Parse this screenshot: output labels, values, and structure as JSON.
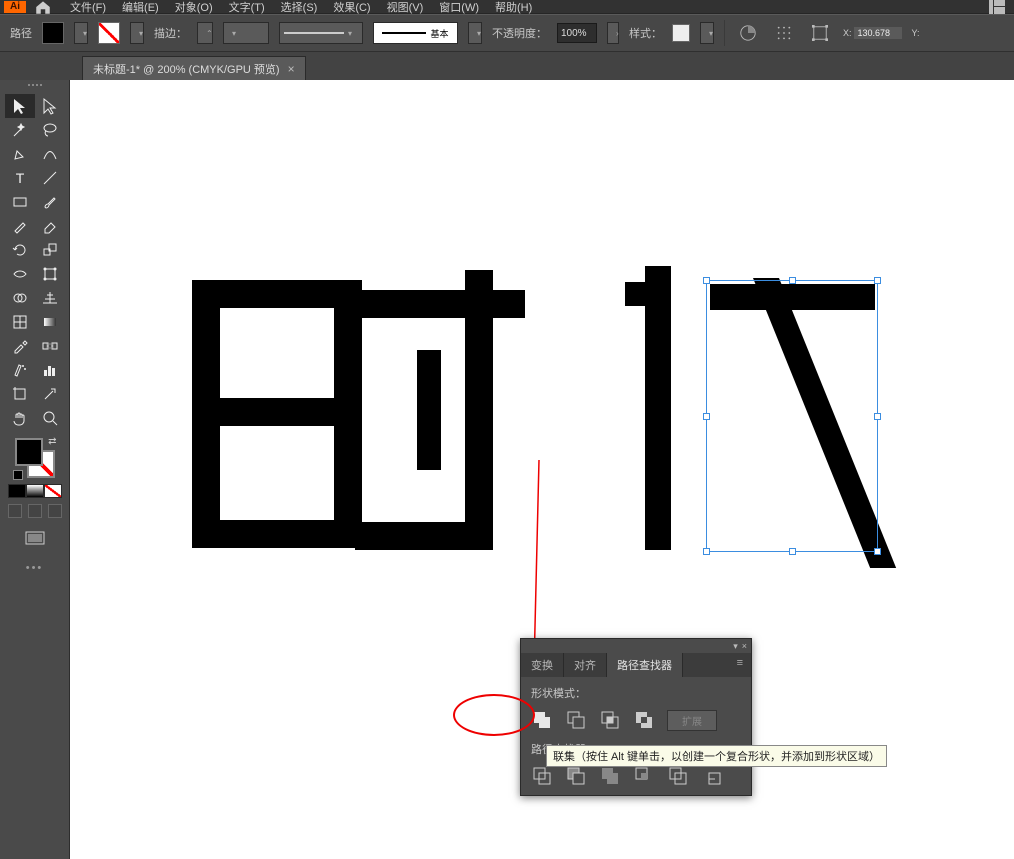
{
  "app": {
    "logo": "Ai"
  },
  "menu": {
    "items": [
      "文件(F)",
      "编辑(E)",
      "对象(O)",
      "文字(T)",
      "选择(S)",
      "效果(C)",
      "视图(V)",
      "窗口(W)",
      "帮助(H)"
    ]
  },
  "control": {
    "mode": "路径",
    "stroke_label": "描边：",
    "stroke_style": "基本",
    "opacity_label": "不透明度：",
    "opacity_value": "100%",
    "style_label": "样式：",
    "x_label": "X:",
    "x_value": "130.678",
    "y_label": "Y:"
  },
  "tab": {
    "title": "未标题-1* @ 200% (CMYK/GPU 预览)",
    "close": "×"
  },
  "panel": {
    "tabs": [
      "变换",
      "对齐",
      "路径查找器"
    ],
    "active_tab": 2,
    "shape_modes_label": "形状模式：",
    "pathfinders_label": "路径查找器：",
    "expand": "扩展",
    "collapse_icon": "▾",
    "close_icon": "×",
    "menu_icon": "≡"
  },
  "tooltip": {
    "text": "联集（按住 Alt 键单击，以创建一个复合形状，并添加到形状区域）"
  },
  "icons": {
    "home": "home-icon",
    "search": "search-icon"
  }
}
